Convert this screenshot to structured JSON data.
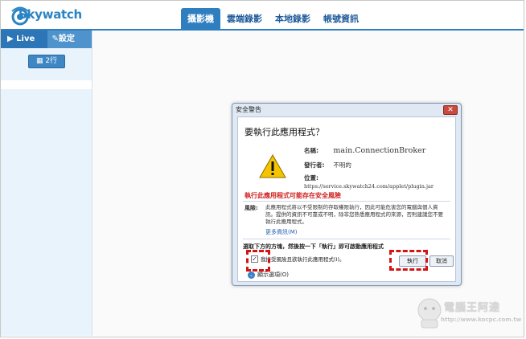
{
  "app": {
    "logo_text": "Skywatch"
  },
  "nav": {
    "tabs": [
      {
        "label": "攝影機"
      },
      {
        "label": "雲端錄影"
      },
      {
        "label": "本地錄影"
      },
      {
        "label": "帳號資訊"
      }
    ]
  },
  "sidebar": {
    "live_label": "▶ Live",
    "settings_label": "設定",
    "grid_button_label": "2行"
  },
  "dialog": {
    "title": "安全警告",
    "close_label": "✕",
    "heading": "要執行此應用程式？",
    "name_label": "名稱:",
    "name_value": "main.ConnectionBroker",
    "publisher_label": "發行者:",
    "publisher_value": "不明的",
    "location_label": "位置:",
    "location_value": "https://service.skywatch24.com/applet/plugin.jar",
    "risk_title": "執行此應用程式可能存在安全風險",
    "risk_label": "風險:",
    "risk_description": "此應用程式將以不受限制的存取權限執行，因此可能危害您的電腦與個人資訊。提供的資訊不可靠或不明，除非您熟悉應用程式的來源，否則建議您不要執行此應用程式。",
    "more_info": "更多資訊(M)",
    "instruction": "選取下方的方塊，然後按一下「執行」即可啟動應用程式",
    "checkbox_label": "我接受風險且欲執行此應用程式(I)。",
    "run_label": "執行",
    "cancel_label": "取消",
    "details_label": "顯示選項(O)"
  },
  "watermark": {
    "text": "電腦王阿達",
    "url": "http://www.kocpc.com.tw"
  },
  "colors": {
    "brand": "#2f7fc0",
    "highlight": "#d21414",
    "risk_text": "#d0211f"
  }
}
